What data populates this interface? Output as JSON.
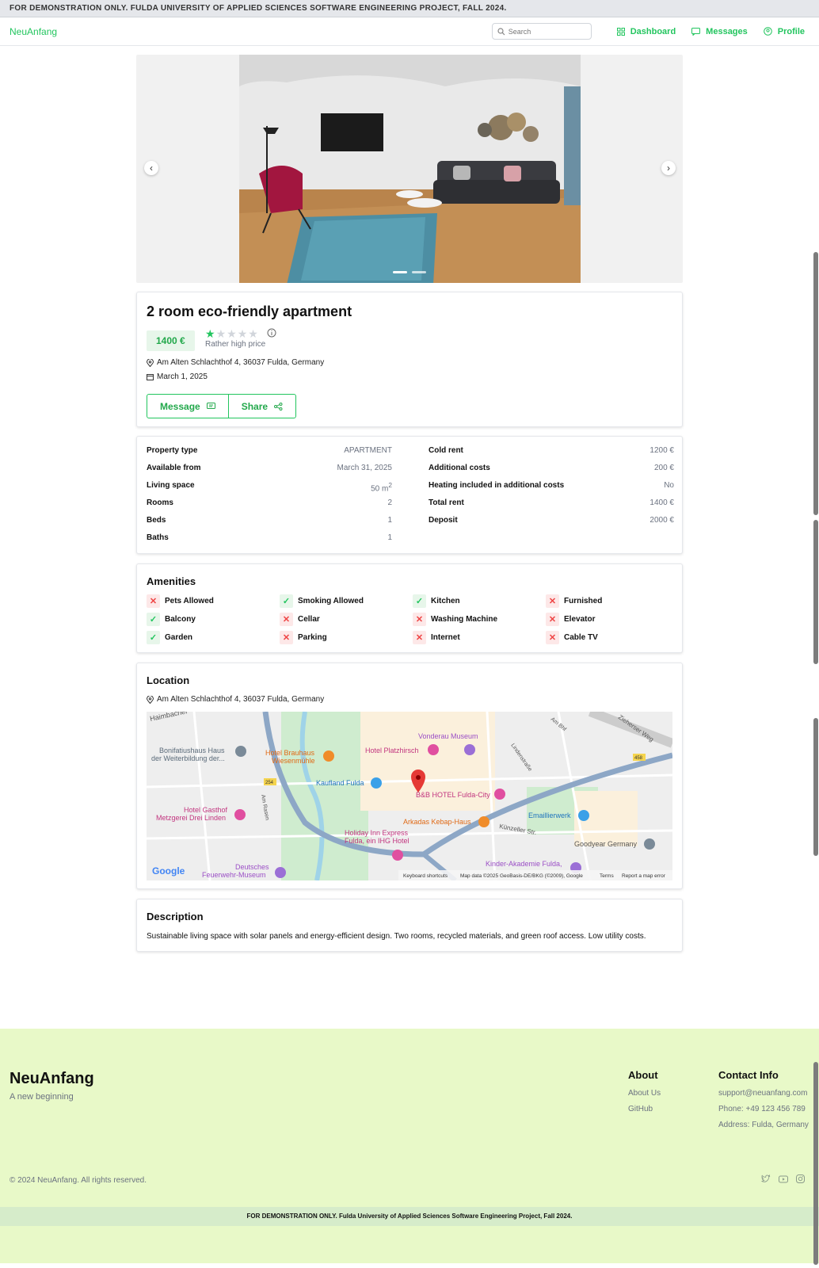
{
  "top_banner": "FOR DEMONSTRATION ONLY. FULDA UNIVERSITY OF APPLIED SCIENCES SOFTWARE ENGINEERING PROJECT, FALL 2024.",
  "nav": {
    "brand": "NeuAnfang",
    "search_placeholder": "Search",
    "dashboard": "Dashboard",
    "messages": "Messages",
    "profile": "Profile",
    "accent": "#22c55e"
  },
  "listing": {
    "title": "2 room eco-friendly apartment",
    "price": "1400 €",
    "rating_filled": 1,
    "rating_total": 5,
    "price_note": "Rather high price",
    "address": "Am Alten Schlachthof 4, 36037 Fulda, Germany",
    "date": "March 1, 2025",
    "message_btn": "Message",
    "share_btn": "Share"
  },
  "details_left": [
    {
      "k": "Property type",
      "v": "APARTMENT"
    },
    {
      "k": "Available from",
      "v": "March 31, 2025"
    },
    {
      "k": "Living space",
      "v": "50 m",
      "sup": "2"
    },
    {
      "k": "Rooms",
      "v": "2"
    },
    {
      "k": "Beds",
      "v": "1"
    },
    {
      "k": "Baths",
      "v": "1"
    }
  ],
  "details_right": [
    {
      "k": "Cold rent",
      "v": "1200 €"
    },
    {
      "k": "Additional costs",
      "v": "200 €"
    },
    {
      "k": "Heating included in additional costs",
      "v": "No"
    },
    {
      "k": "Total rent",
      "v": "1400 €"
    },
    {
      "k": "Deposit",
      "v": "2000 €"
    }
  ],
  "amenities": {
    "title": "Amenities",
    "items": [
      {
        "l": "Pets Allowed",
        "ok": false
      },
      {
        "l": "Smoking Allowed",
        "ok": true
      },
      {
        "l": "Kitchen",
        "ok": true
      },
      {
        "l": "Furnished",
        "ok": false
      },
      {
        "l": "Balcony",
        "ok": true
      },
      {
        "l": "Cellar",
        "ok": false
      },
      {
        "l": "Washing Machine",
        "ok": false
      },
      {
        "l": "Elevator",
        "ok": false
      },
      {
        "l": "Garden",
        "ok": true
      },
      {
        "l": "Parking",
        "ok": false
      },
      {
        "l": "Internet",
        "ok": false
      },
      {
        "l": "Cable TV",
        "ok": false
      }
    ]
  },
  "location": {
    "title": "Location",
    "address": "Am Alten Schlachthof 4, 36037 Fulda, Germany",
    "map_labels": {
      "haimbacher": "Haimbacher",
      "bonif1": "Bonifatiushaus Haus",
      "bonif2": "der Weiterbildung der...",
      "brauhaus1": "Hotel Brauhaus",
      "brauhaus2": "Wiesenmühle",
      "platz": "Hotel Platzhirsch",
      "vonderau": "Vonderau Museum",
      "kaufland": "Kaufland Fulda",
      "bb": "B&B HOTEL Fulda-City",
      "gasthof1": "Hotel Gasthof",
      "gasthof2": "Metzgerei Drei Linden",
      "arkadas": "Arkadas Kebap-Haus",
      "email": "Emaillierwerk",
      "holiday1": "Holiday Inn Express",
      "holiday2": "Fulda, ein IHG Hotel",
      "goodyear": "Goodyear Germany",
      "kinder": "Kinder-Akademie Fulda,",
      "deutsches1": "Deutsches",
      "deutsches2": "Feuerwehr-Museum",
      "amrasen": "Am Rasen",
      "linden": "Lindenstraße",
      "ziehers": "Zieherser Weg",
      "kuenzeller": "Künzeller Str.",
      "amrbhf": "Am Bhf",
      "r254": "254",
      "r458": "458",
      "google": "Google",
      "attr_kb": "Keyboard shortcuts",
      "attr_data": "Map data ©2025 GeoBasis-DE/BKG (©2009), Google",
      "attr_terms": "Terms",
      "attr_report": "Report a map error"
    }
  },
  "description": {
    "title": "Description",
    "text": "Sustainable living space with solar panels and energy-efficient design. Two rooms, recycled materials, and green roof access. Low utility costs."
  },
  "footer": {
    "brand": "NeuAnfang",
    "tagline": "A new beginning",
    "about_title": "About",
    "about_us": "About Us",
    "github": "GitHub",
    "contact_title": "Contact Info",
    "email": "support@neuanfang.com",
    "phone": "Phone: +49 123 456 789",
    "address": "Address: Fulda, Germany",
    "copyright": "© 2024 NeuAnfang. All rights reserved.",
    "banner": "FOR DEMONSTRATION ONLY. Fulda University of Applied Sciences Software Engineering Project, Fall 2024.",
    "bg": "#e8f9c8"
  }
}
